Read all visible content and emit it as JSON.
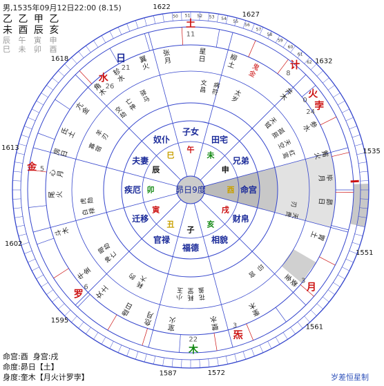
{
  "header": {
    "line1": "男,1535年09月12日22:00 (8.15)",
    "stems": "乙 乙 甲 乙",
    "branches": "未 酉 辰 亥",
    "hidden1": "辰 午 寅 申",
    "hidden2": "巳 未 卯 酉"
  },
  "footer": {
    "line1": "命宫:酉  身宫:戌",
    "line2": "命度:昴日【土】",
    "line3": "身度:奎木【月火计罗孛】"
  },
  "credit": "岁差恒星制",
  "center_label": "昴日9度",
  "colors": {
    "ring": "#3344cc",
    "palace_text": "#1a2a99",
    "red": "#cc1111",
    "shade": "#c8c8c8"
  },
  "palaces": [
    {
      "name": "命宫",
      "branch": "酉",
      "branch_color": "#c8a000",
      "angle": 0,
      "shaded": true
    },
    {
      "name": "兄弟",
      "branch": "申",
      "branch_color": "#111111",
      "angle": 30
    },
    {
      "name": "田宅",
      "branch": "未",
      "branch_color": "#118811",
      "angle": 60
    },
    {
      "name": "子女",
      "branch": "午",
      "branch_color": "#cc1111",
      "angle": 90
    },
    {
      "name": "奴仆",
      "branch": "巳",
      "branch_color": "#c8a000",
      "angle": 120
    },
    {
      "name": "夫妻",
      "branch": "辰",
      "branch_color": "#111111",
      "angle": 150
    },
    {
      "name": "疾厄",
      "branch": "卯",
      "branch_color": "#118811",
      "angle": 180
    },
    {
      "name": "迁移",
      "branch": "寅",
      "branch_color": "#cc1111",
      "angle": 210
    },
    {
      "name": "官禄",
      "branch": "丑",
      "branch_color": "#c8a000",
      "angle": 240
    },
    {
      "name": "福德",
      "branch": "子",
      "branch_color": "#111111",
      "angle": 270
    },
    {
      "name": "相貌",
      "branch": "亥",
      "branch_color": "#118811",
      "angle": 300
    },
    {
      "name": "财帛",
      "branch": "戌",
      "branch_color": "#cc1111",
      "angle": 330
    }
  ],
  "stars_ring": [
    {
      "text": "张月",
      "angle": 100
    },
    {
      "text": "星日",
      "angle": 85
    },
    {
      "text": "柳土",
      "angle": 72
    },
    {
      "text": "鬼金",
      "angle": 62,
      "color": "#cc1111"
    },
    {
      "text": "井木",
      "angle": 45
    },
    {
      "text": "参水",
      "angle": 28
    },
    {
      "text": "觜火",
      "angle": 15
    },
    {
      "text": "毕月",
      "angle": 5
    },
    {
      "text": "昴日",
      "angle": -5
    },
    {
      "text": "胃土",
      "angle": -20
    },
    {
      "text": "娄金",
      "angle": -42
    },
    {
      "text": "奎木",
      "angle": -62
    },
    {
      "text": "壁水",
      "angle": -80
    },
    {
      "text": "室火",
      "angle": -98
    },
    {
      "text": "危月",
      "angle": -108
    },
    {
      "text": "虚日",
      "angle": -118
    },
    {
      "text": "女土",
      "angle": -131
    },
    {
      "text": "牛金",
      "angle": -142
    },
    {
      "text": "斗木",
      "angle": -162
    },
    {
      "text": "尾火",
      "angle": -178
    },
    {
      "text": "心月",
      "angle": 173
    },
    {
      "text": "房日",
      "angle": 164
    },
    {
      "text": "氐土",
      "angle": 155
    },
    {
      "text": "亢金",
      "angle": 143
    },
    {
      "text": "角木",
      "angle": 132
    },
    {
      "text": "轸水",
      "angle": 122
    },
    {
      "text": "翼火",
      "angle": 110
    }
  ],
  "shensha": [
    {
      "text": "文昌",
      "angle": 83
    },
    {
      "text": "病符",
      "angle": 76
    },
    {
      "text": "太岁",
      "angle": 64
    },
    {
      "text": "天钺",
      "angle": 40
    },
    {
      "text": "孤辰",
      "angle": 33
    },
    {
      "text": "天空",
      "angle": 26
    },
    {
      "text": "红鸾",
      "angle": 20
    },
    {
      "text": "刃",
      "angle": -8
    },
    {
      "text": "天贵",
      "angle": -14
    },
    {
      "text": "印",
      "angle": -48
    },
    {
      "text": "宫",
      "angle": -54
    },
    {
      "text": "花盖",
      "angle": -84
    },
    {
      "text": "耗堂",
      "angle": -90
    },
    {
      "text": "小玉",
      "angle": -96
    },
    {
      "text": "耗大",
      "angle": -118
    },
    {
      "text": "的",
      "angle": -124
    },
    {
      "text": "神亡",
      "angle": -140
    },
    {
      "text": "暗劫",
      "angle": -146
    },
    {
      "text": "白禄",
      "angle": -168
    },
    {
      "text": "虎勋",
      "angle": -174
    },
    {
      "text": "寡宿",
      "angle": 156
    },
    {
      "text": "羊刃",
      "angle": 148
    },
    {
      "text": "亡神",
      "angle": 125
    },
    {
      "text": "驿马",
      "angle": 116
    },
    {
      "text": "交劫",
      "angle": 132
    }
  ],
  "planets": [
    {
      "text": "土",
      "angle": 90,
      "r": 240,
      "color": "#cc1111",
      "num": "11"
    },
    {
      "text": "计",
      "angle": 50,
      "r": 235,
      "color": "#cc1111",
      "num": "8"
    },
    {
      "text": "火",
      "angle": 38,
      "r": 225,
      "color": "#cc1111",
      "num": "0"
    },
    {
      "text": "孛",
      "angle": 33,
      "r": 222,
      "color": "#cc1111",
      "num": "24"
    },
    {
      "text": "日",
      "angle": 118,
      "r": 215,
      "color": "#1a2a99",
      "num": "21"
    },
    {
      "text": "水",
      "angle": 128,
      "r": 205,
      "color": "#cc1111",
      "num": "26"
    },
    {
      "text": "金",
      "angle": 172,
      "r": 232,
      "color": "#cc1111",
      "num": "5"
    },
    {
      "text": "罗",
      "angle": -137,
      "r": 222,
      "color": "#cc1111",
      "num": "6"
    },
    {
      "text": "炁",
      "angle": -72,
      "r": 222,
      "color": "#cc1111",
      "num": "3"
    },
    {
      "text": "木",
      "angle": -89,
      "r": 232,
      "color": "#118811",
      "num": "22"
    },
    {
      "text": "月",
      "angle": -39,
      "r": 225,
      "color": "#cc1111",
      "num": "3"
    }
  ],
  "years": [
    {
      "text": "1622",
      "angle": 99
    },
    {
      "text": "1627",
      "angle": 71
    },
    {
      "text": "1632",
      "angle": 44
    },
    {
      "text": "1535",
      "angle": 12
    },
    {
      "text": "1551",
      "angle": -20
    },
    {
      "text": "1561",
      "angle": -48
    },
    {
      "text": "1572",
      "angle": -82
    },
    {
      "text": "1587",
      "angle": -97
    },
    {
      "text": "1595",
      "angle": -135
    },
    {
      "text": "1602",
      "angle": -163
    },
    {
      "text": "1613",
      "angle": 167
    },
    {
      "text": "1618",
      "angle": 135
    }
  ],
  "degree_ticks": [
    "50",
    "51",
    "52",
    "53",
    "54",
    "55",
    "56",
    "57",
    "58",
    "59",
    "60",
    "61",
    "62",
    "63",
    "64",
    "65",
    "66",
    "67",
    "68",
    "69",
    "70",
    "71",
    "72",
    "73",
    "74",
    "75",
    "76",
    "77",
    "78",
    "79",
    "80",
    "81",
    "82",
    "83",
    "84",
    "85",
    "86",
    "87",
    "88",
    "89",
    "90",
    "91",
    "92",
    "93"
  ]
}
